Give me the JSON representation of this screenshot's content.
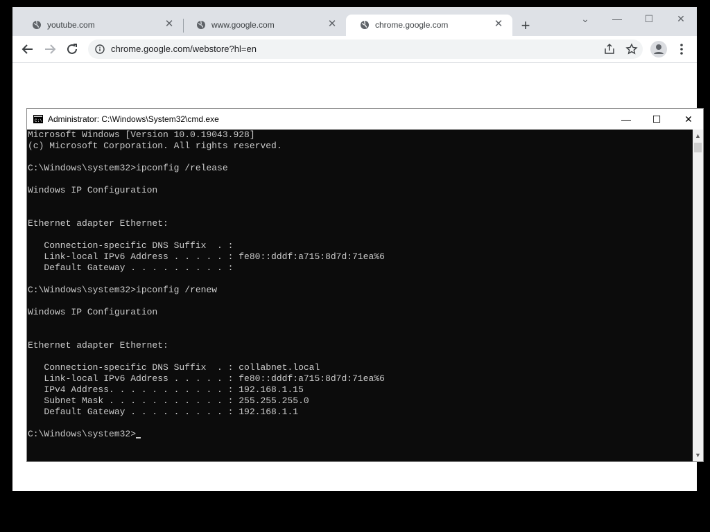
{
  "browser": {
    "tabs": [
      {
        "title": "youtube.com",
        "close": "✕"
      },
      {
        "title": "www.google.com",
        "close": "✕"
      },
      {
        "title": "chrome.google.com",
        "close": "✕"
      }
    ],
    "new_tab": "+",
    "window_controls": {
      "tabsearch": "⌄",
      "minimize": "—",
      "maximize": "☐",
      "close": "✕"
    },
    "url": "chrome.google.com/webstore?hl=en"
  },
  "cmd": {
    "title": "Administrator: C:\\Windows\\System32\\cmd.exe",
    "controls": {
      "minimize": "—",
      "maximize": "☐",
      "close": "✕"
    },
    "lines": [
      "Microsoft Windows [Version 10.0.19043.928]",
      "(c) Microsoft Corporation. All rights reserved.",
      "",
      "C:\\Windows\\system32>ipconfig /release",
      "",
      "Windows IP Configuration",
      "",
      "",
      "Ethernet adapter Ethernet:",
      "",
      "   Connection-specific DNS Suffix  . :",
      "   Link-local IPv6 Address . . . . . : fe80::dddf:a715:8d7d:71ea%6",
      "   Default Gateway . . . . . . . . . :",
      "",
      "C:\\Windows\\system32>ipconfig /renew",
      "",
      "Windows IP Configuration",
      "",
      "",
      "Ethernet adapter Ethernet:",
      "",
      "   Connection-specific DNS Suffix  . : collabnet.local",
      "   Link-local IPv6 Address . . . . . : fe80::dddf:a715:8d7d:71ea%6",
      "   IPv4 Address. . . . . . . . . . . : 192.168.1.15",
      "   Subnet Mask . . . . . . . . . . . : 255.255.255.0",
      "   Default Gateway . . . . . . . . . : 192.168.1.1",
      ""
    ],
    "prompt": "C:\\Windows\\system32>"
  }
}
